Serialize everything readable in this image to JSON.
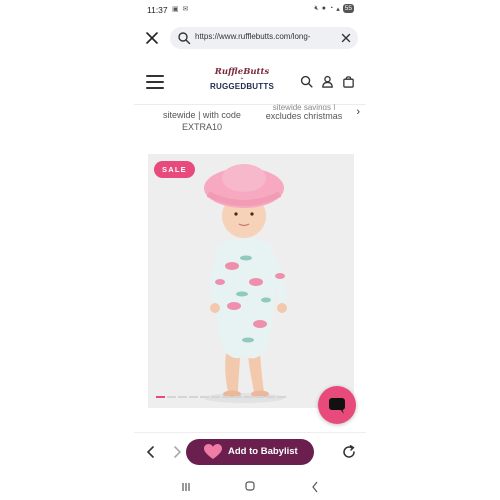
{
  "status_bar": {
    "time": "11:37",
    "battery": "55"
  },
  "browser": {
    "url": "https://www.rufflebutts.com/long-"
  },
  "site": {
    "logo_top": "RuffleButts",
    "logo_amp": "+",
    "logo_bottom": "RUGGEDBUTTS"
  },
  "promo": {
    "line1_a": "sitewide | with code",
    "line1_b": "EXTRA10",
    "line2_top": "sitewide savings |",
    "line2_b": "excludes christmas"
  },
  "product": {
    "badge": "SALE",
    "image_slides": 12,
    "active_slide": 1
  },
  "bottom_bar": {
    "add_button": "Add to Babylist"
  },
  "colors": {
    "accent_pink": "#e74a7b",
    "babylist_purple": "#6b1f4f",
    "logo_maroon": "#7a2a3e",
    "logo_navy": "#1d2d4e"
  },
  "icons": {
    "url_close": "close-icon",
    "url_search": "search-icon",
    "url_clear": "clear-icon",
    "menu": "hamburger-menu-icon",
    "search": "search-icon",
    "account": "account-icon",
    "bag": "shopping-bag-icon",
    "chat": "chat-icon",
    "back": "chevron-left-icon",
    "forward": "chevron-right-icon",
    "refresh": "refresh-icon"
  }
}
